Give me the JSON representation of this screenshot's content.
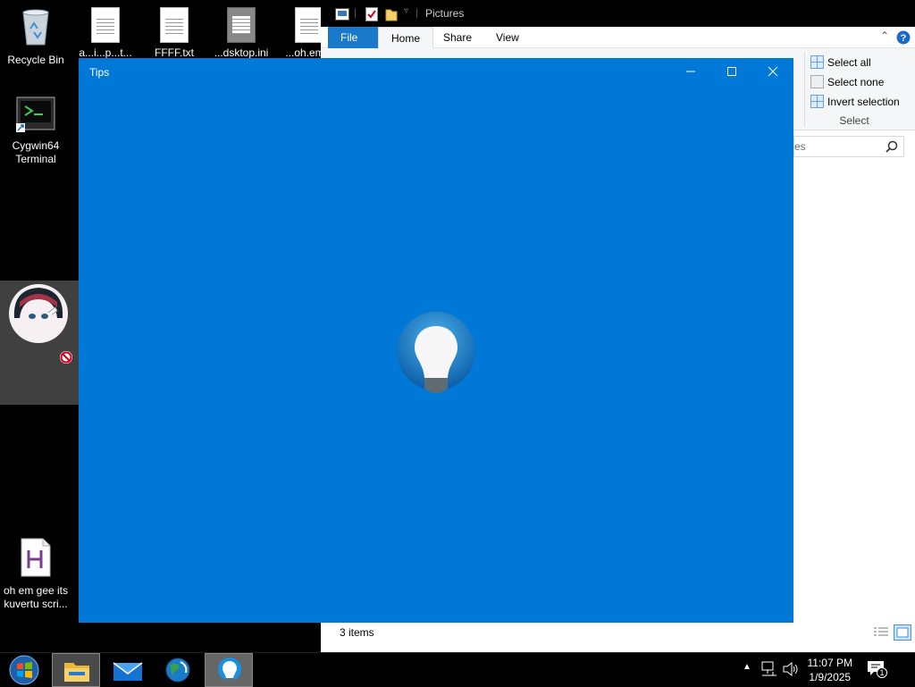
{
  "desktop": {
    "icons": [
      {
        "label": "Recycle Bin",
        "icon": "recycle-bin-icon"
      },
      {
        "label": "Cygwin64 Terminal",
        "icon": "terminal-icon"
      },
      {
        "label": "oh em gee its kuvertu scri...",
        "icon": "h-script-icon"
      }
    ],
    "top_row_labels": [
      "a...i...p...t...",
      "FFFF.txt",
      "...dsktop.ini",
      "...oh.em..."
    ]
  },
  "explorer": {
    "title": "Pictures",
    "tabs": [
      "File",
      "Home",
      "Share",
      "View"
    ],
    "select_group": {
      "select_all": "Select all",
      "select_none": "Select none",
      "invert_selection": "Invert selection",
      "group_label": "Select"
    },
    "search_placeholder": "es",
    "status": "3 items"
  },
  "tips": {
    "title": "Tips",
    "accent": "#0078d7"
  },
  "taskbar": {
    "apps": [
      "start-orb",
      "file-explorer-icon",
      "mail-icon",
      "browser-globe-icon",
      "tips-lightbulb-icon"
    ],
    "time": "11:07 PM",
    "date": "1/9/2025",
    "notification_count": "1"
  }
}
